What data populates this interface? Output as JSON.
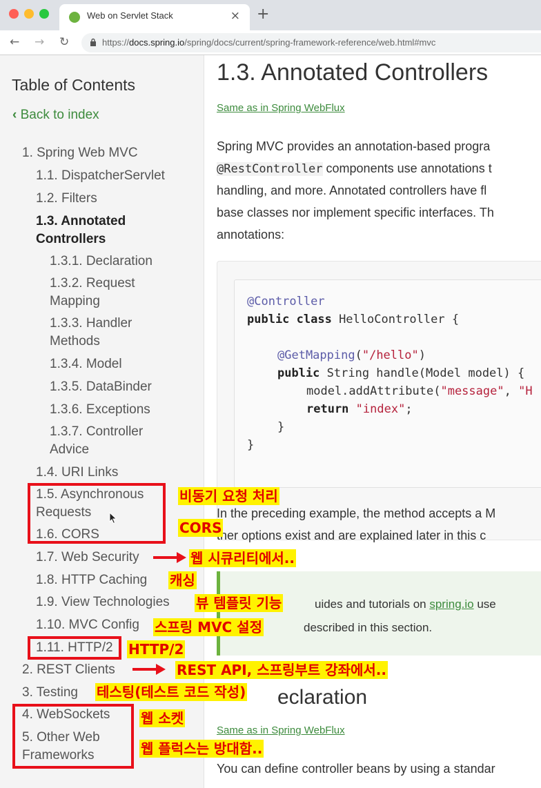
{
  "browser": {
    "tab_title": "Web on Servlet Stack",
    "url_domain": "docs.spring.io",
    "url_rest": "/spring/docs/current/spring-framework-reference/web.html#mvc",
    "url_prefix": "https://"
  },
  "sidebar": {
    "title": "Table of Contents",
    "back_label": "Back to index",
    "items": [
      "1. Spring Web MVC",
      "1.1. DispatcherServlet",
      "1.2. Filters",
      "1.3. Annotated",
      "Controllers",
      "1.3.1. Declaration",
      "1.3.2. Request",
      "Mapping",
      "1.3.3. Handler",
      "Methods",
      "1.3.4. Model",
      "1.3.5. DataBinder",
      "1.3.6. Exceptions",
      "1.3.7. Controller",
      "Advice",
      "1.4. URI Links",
      "1.5. Asynchronous",
      "Requests",
      "1.6. CORS",
      "1.7. Web Security",
      "1.8. HTTP Caching",
      "1.9. View Technologies",
      "1.10. MVC Config",
      "1.11. HTTP/2",
      "2. REST Clients",
      "3. Testing",
      "4. WebSockets",
      "5. Other Web",
      "Frameworks"
    ]
  },
  "annotations": [
    "비동기 요청 처리",
    "CORS",
    "웹 시큐리티에서..",
    "캐싱",
    "뷰 템플릿 기능",
    "스프링 MVC 설정",
    "HTTP/2",
    "REST API, 스프링부트 강좌에서..",
    "테스팅(테스트 코드 작성)",
    "웹 소켓",
    "웹 플럭스는 방대함.."
  ],
  "content": {
    "heading": "1.3. Annotated Controllers",
    "same_as_link": "Same as in Spring WebFlux",
    "para1_line1": "Spring MVC provides an annotation-based progra",
    "para1_line2_code": "@RestController",
    "para1_line2_rest": " components use annotations t",
    "para1_line3": "handling, and more. Annotated controllers have fl",
    "para1_line4": "base classes nor implement specific interfaces. Th",
    "para1_line5": "annotations:",
    "code": {
      "l1": "@Controller",
      "l2a": "public class",
      "l2b": " HelloController {",
      "l3a": "@GetMapping",
      "l3b": "(",
      "l3c": "\"/hello\"",
      "l3d": ")",
      "l4a": "public",
      "l4b": " String handle(Model model) {",
      "l5a": "model.addAttribute(",
      "l5b": "\"message\"",
      "l5c": ", ",
      "l5d": "\"H",
      "l6a": "return",
      "l6b": " \"index\"",
      "l6c": ";",
      "l7": "}",
      "l8": "}"
    },
    "para2_line1": "In the preceding example, the method accepts a M",
    "para2_line2": "ther options exist and are explained later in this c",
    "tip_line1_a": "uides and tutorials on ",
    "tip_link": "spring.io",
    "tip_line1_b": " use",
    "tip_line2": "described in this section.",
    "heading2": "eclaration",
    "same_as_link2": "Same as in Spring WebFlux",
    "para3": "You can define controller beans by using a standar"
  }
}
